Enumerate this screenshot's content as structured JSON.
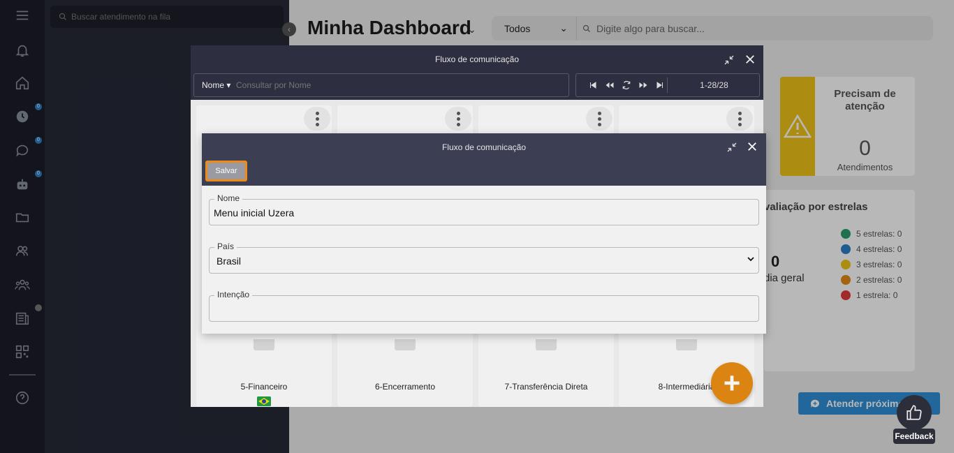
{
  "queue": {
    "search_placeholder": "Buscar atendimento na fila"
  },
  "rail": {
    "badges": [
      "0",
      "0",
      "0"
    ]
  },
  "dashboard": {
    "title": "Minha Dashboard",
    "filter_selected": "Todos",
    "search_placeholder": "Digite algo para buscar...",
    "attention": {
      "title": "Precisam de atenção",
      "value": "0",
      "label": "Atendimentos"
    },
    "rating": {
      "title": "valiação por estrelas",
      "average": "0",
      "average_label": "dia geral",
      "legend": [
        {
          "label": "5 estrelas: 0",
          "color": "#2a9d6f"
        },
        {
          "label": "4 estrelas: 0",
          "color": "#2f7fc9"
        },
        {
          "label": "3 estrelas: 0",
          "color": "#f0c418"
        },
        {
          "label": "2 estrelas: 0",
          "color": "#e58a13"
        },
        {
          "label": "1 estrela: 0",
          "color": "#e03b3b"
        }
      ]
    },
    "attend_next_label": "Atender próximo",
    "feedback_label": "Feedback"
  },
  "outer_modal": {
    "title": "Fluxo de comunicação",
    "search_field": "Nome",
    "search_placeholder": "Consultar por Nome",
    "pager_count": "1-28/28",
    "cards": [
      {
        "name": "5-Financeiro"
      },
      {
        "name": "6-Encerramento"
      },
      {
        "name": "7-Transferência Direta"
      },
      {
        "name": "8-Intermediária"
      }
    ],
    "fab_label": "+"
  },
  "inner_modal": {
    "title": "Fluxo de comunicação",
    "save_label": "Salvar",
    "fields": {
      "nome": {
        "label": "Nome",
        "value": "Menu inicial Uzera"
      },
      "pais": {
        "label": "País",
        "value": "Brasil"
      },
      "intencao": {
        "label": "Intenção",
        "value": ""
      }
    }
  }
}
